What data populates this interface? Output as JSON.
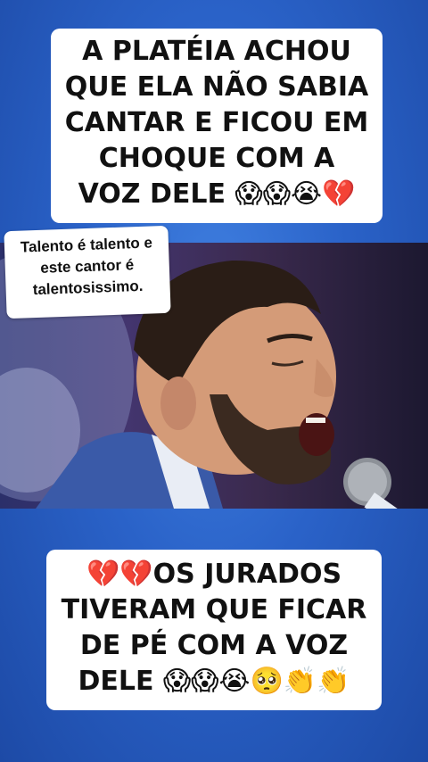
{
  "top_caption": {
    "lines": [
      "A PLATÉIA ACHOU",
      "QUE ELA NÃO SABIA",
      "CANTAR E FICOU EM",
      "CHOQUE COM A",
      "VOZ DELE 😱😱😭💔"
    ]
  },
  "comment_sticker": {
    "lines": [
      "Talento é talento e",
      "este cantor é",
      "talentosissimo."
    ]
  },
  "bottom_caption": {
    "lines": [
      "💔💔OS JURADOS",
      "TIVERAM QUE FICAR",
      "DE PÉ COM A VOZ",
      "DELE 😱😱😭🥺👏👏"
    ]
  },
  "colors": {
    "background": "#2a62c8",
    "caption_bg": "#ffffff",
    "caption_text": "#111111"
  }
}
